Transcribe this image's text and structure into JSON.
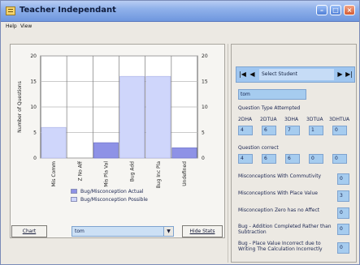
{
  "window": {
    "title": "Teacher Independant"
  },
  "menu": {
    "items": [
      {
        "label": "Help"
      },
      {
        "label": "View"
      }
    ]
  },
  "chart_data": {
    "type": "bar",
    "categories": [
      "Mis Comm",
      "Z No Aff",
      "Mis Pla Val",
      "Bug Add",
      "Bug Inc Pla",
      "Undefined"
    ],
    "series": [
      {
        "name": "Bug/Misconception Actual",
        "values": [
          0,
          0,
          3,
          0,
          0,
          2
        ]
      },
      {
        "name": "Bug/Misconception Possible",
        "values": [
          6,
          0,
          3,
          16,
          16,
          2
        ]
      }
    ],
    "ylabel": "Number of Questions",
    "ylim": [
      0,
      20
    ],
    "yticks": [
      0,
      5,
      10,
      15,
      20
    ],
    "grid": true,
    "colors": {
      "actual": "#8e92e6",
      "possible": "#cfd6fb"
    }
  },
  "legend": {
    "actual": "Bug/Misconception Actual",
    "possible": "Bug/Misconception Possible"
  },
  "controls": {
    "chart_label": "Chart",
    "student_value": "tom",
    "hide_stats_label": "Hide Stats"
  },
  "nav": {
    "placeholder": "Select Student",
    "first": "|◀",
    "prev": "◀",
    "next": "▶",
    "last": "▶|"
  },
  "student": {
    "name": "tom"
  },
  "question_type": {
    "heading": "Question Type Attempted",
    "columns": [
      "2DHA",
      "2DTUA",
      "3DHA",
      "3DTUA",
      "3DHTUA"
    ],
    "values": [
      "4",
      "6",
      "7",
      "1",
      "0"
    ]
  },
  "question_correct": {
    "heading": "Question correct",
    "values": [
      "4",
      "6",
      "6",
      "0",
      "0"
    ]
  },
  "misconceptions": [
    {
      "label": "Misconceptions With Commutivity",
      "value": "0"
    },
    {
      "label": "Misconceptions With Place Value",
      "value": "3"
    },
    {
      "label": "Misconception Zero has no Affect",
      "value": "0"
    },
    {
      "label": "Bug - Addition Completed Rather than Subtraction",
      "value": "0"
    },
    {
      "label": "Bug - Place Value Incorrect due to Writing The Calculation Incorrectly",
      "value": "0"
    }
  ]
}
